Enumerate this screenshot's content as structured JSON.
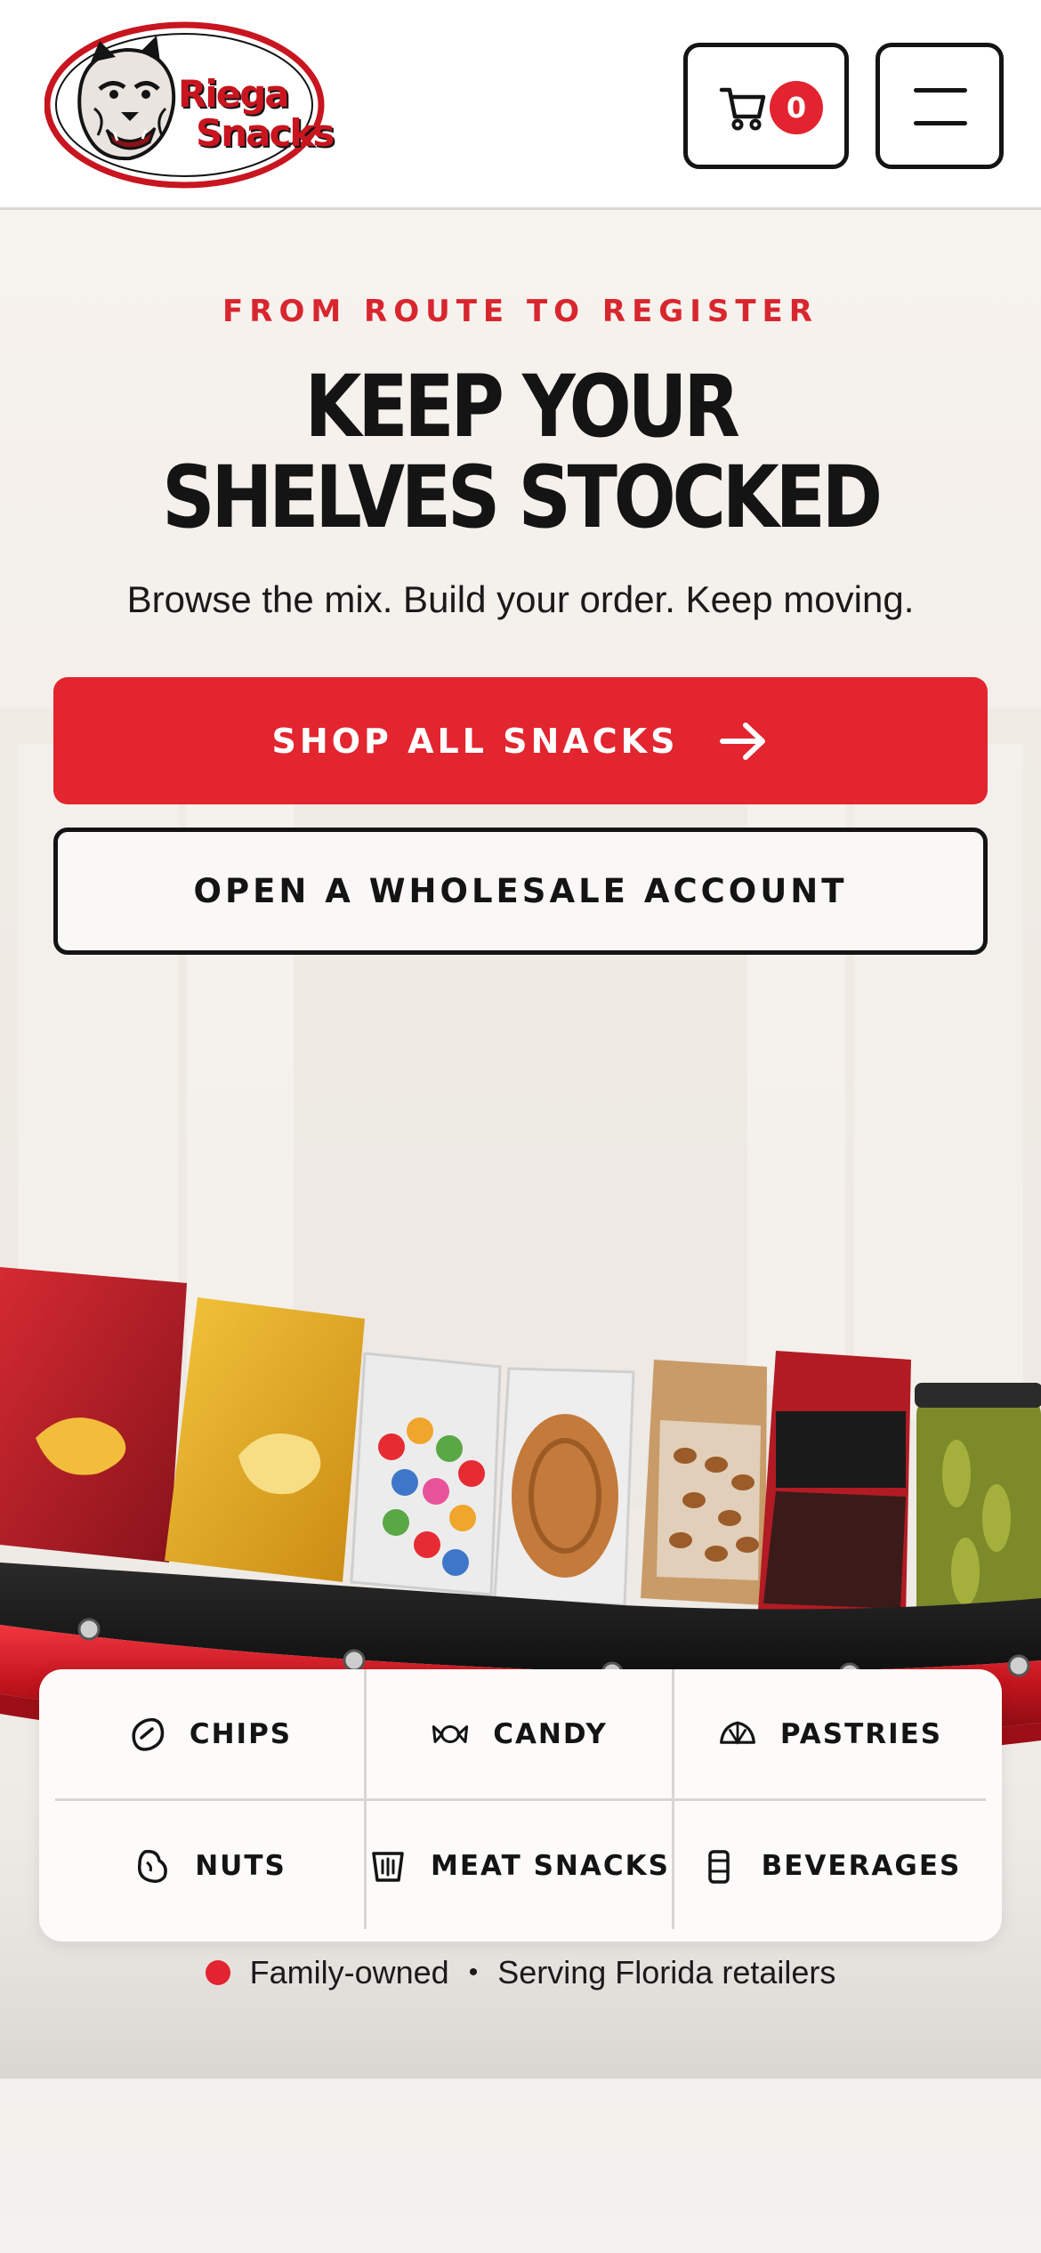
{
  "brand": {
    "name_line1": "Riega",
    "name_line2": "Snacks"
  },
  "cart": {
    "count": "0"
  },
  "hero": {
    "eyebrow": "FROM ROUTE TO REGISTER",
    "headline_line1": "KEEP YOUR",
    "headline_line2": "SHELVES STOCKED",
    "subhead": "Browse the mix. Build your order. Keep moving.",
    "primary_cta": "SHOP ALL SNACKS",
    "secondary_cta": "OPEN A WHOLESALE ACCOUNT"
  },
  "categories": [
    {
      "label": "CHIPS",
      "icon": "chip-icon"
    },
    {
      "label": "CANDY",
      "icon": "candy-icon"
    },
    {
      "label": "PASTRIES",
      "icon": "pastry-icon"
    },
    {
      "label": "NUTS",
      "icon": "nut-icon"
    },
    {
      "label": "MEAT SNACKS",
      "icon": "meat-snack-icon"
    },
    {
      "label": "BEVERAGES",
      "icon": "beverage-icon"
    }
  ],
  "tagline": {
    "part1": "Family-owned",
    "separator": "•",
    "part2": "Serving Florida retailers"
  },
  "colors": {
    "accent": "#e3232f",
    "ink": "#141414",
    "background": "#f3efeb"
  }
}
